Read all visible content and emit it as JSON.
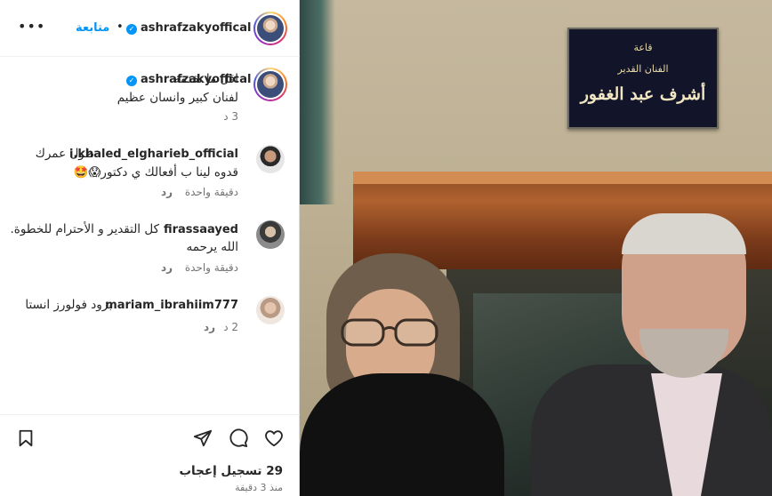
{
  "post": {
    "username": "ashrafzakyoffical",
    "follow_label": "متابعة",
    "separator": "•",
    "more": "•••",
    "caption_line1": "اقل ما نقدمه",
    "caption_line2": "لفنان كبير وانسان عظيم",
    "caption_time": "3 د"
  },
  "comments": [
    {
      "username": "i.khaled_elgharieb_official",
      "line1": "طول عمرك",
      "line2": "قدوه لينا ب أفعالك ي دكتور😱🤩",
      "time": "دقيقة واحدة",
      "reply": "رد"
    },
    {
      "username": "firassaayed",
      "line1": "كل التقدير و الأحترام للخطوة.",
      "line2": "الله يرحمه",
      "time": "دقيقة واحدة",
      "reply": "رد"
    },
    {
      "username": "mariam_ibrahiim777",
      "line1": "بزود فولورز انستا",
      "time": "2 د",
      "reply": "رد"
    }
  ],
  "footer": {
    "likes": "29 تسجيل إعجاب",
    "posted_ago": "منذ 3 دقيقة"
  },
  "photo": {
    "sign_line1": "قاعة",
    "sign_line2": "الفنان القدير",
    "sign_line3": "أشرف عبد الغفور"
  },
  "icons": [
    "more-icon",
    "verified-icon",
    "like-icon",
    "comment-icon",
    "share-icon",
    "save-icon"
  ],
  "colors": {
    "accent": "#0095f6",
    "text": "#262626",
    "muted": "#737373"
  }
}
